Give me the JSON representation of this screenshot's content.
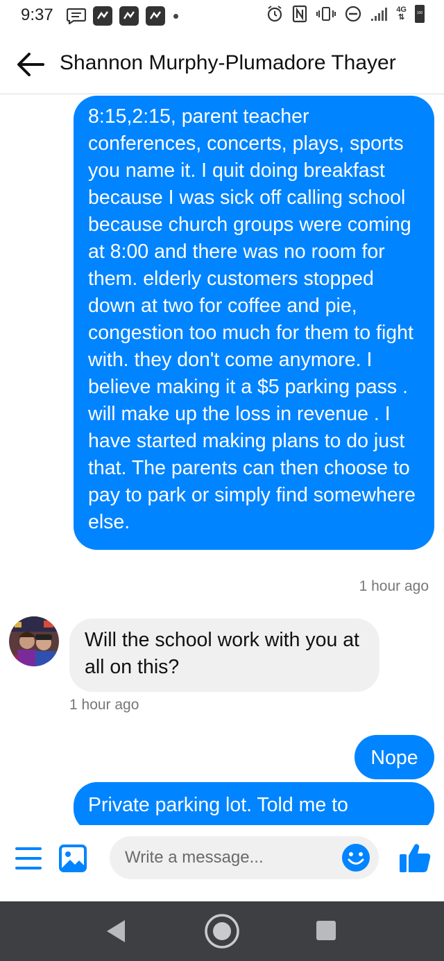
{
  "status_bar": {
    "time": "9:37",
    "network": "4G",
    "battery": "100"
  },
  "header": {
    "title": "Shannon Murphy-Plumadore Thayer",
    "back_icon": "arrow-left-icon"
  },
  "messages": [
    {
      "direction": "outgoing",
      "text": "8:15,2:15, parent teacher conferences, concerts, plays, sports you name it. I quit doing breakfast because I was sick off calling school because church groups were coming at 8:00 and there was no room for them. elderly customers stopped down at two for coffee and pie, congestion too much for them to fight with. they don't come anymore. I believe making it a $5 parking pass . will make up the loss in revenue . I have started making plans to do just that. The parents can then choose to pay to park or simply find somewhere else.",
      "timestamp": "1 hour ago"
    },
    {
      "direction": "incoming",
      "text": "Will the school work with you at all on this?",
      "timestamp": "1 hour ago"
    },
    {
      "direction": "outgoing",
      "text": "Nope"
    },
    {
      "direction": "outgoing",
      "text": "Private parking lot. Told me to"
    }
  ],
  "composer": {
    "placeholder": "Write a message...",
    "icons": [
      "menu-icon",
      "image-icon",
      "emoji-icon",
      "thumbs-up-icon"
    ]
  },
  "colors": {
    "accent": "#0084ff",
    "incoming_bubble": "#f0f0f0",
    "nav_bar": "#3d3f43"
  }
}
